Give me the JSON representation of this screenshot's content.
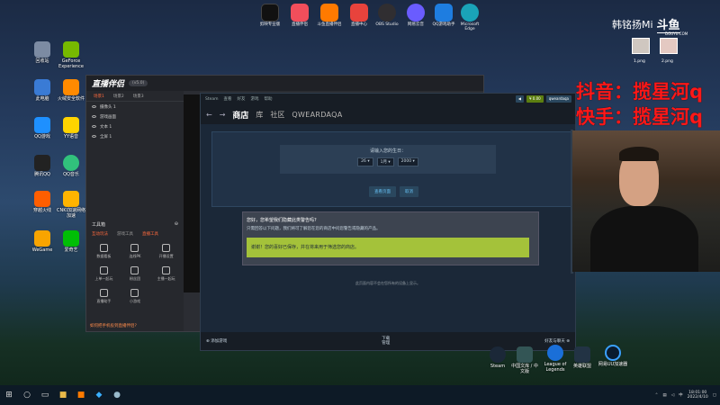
{
  "top_icons": [
    {
      "label": "剪映专业版",
      "color": "#111111"
    },
    {
      "label": "直播伴侣",
      "color": "#f24e5b"
    },
    {
      "label": "斗鱼直播伴侣",
      "color": "#ff7a00"
    },
    {
      "label": "直播中心",
      "color": "#e8433c"
    },
    {
      "label": "OBS Studio",
      "color": "#302e31"
    },
    {
      "label": "网易云音",
      "color": "#6a5cff"
    },
    {
      "label": "QQ游戏助手",
      "color": "#1e7de0"
    },
    {
      "label": "Microsoft Edge",
      "color": "#1aa3b8"
    }
  ],
  "desktop_icons": [
    {
      "label": "回收站",
      "color": "#7c8ba3"
    },
    {
      "label": "GeForce Experience",
      "color": "#76b900"
    },
    {
      "label": "此电脑",
      "color": "#3a7bd5"
    },
    {
      "label": "火绒安全软件",
      "color": "#ff8a00"
    },
    {
      "label": "QQ游戏",
      "color": "#1e90ff"
    },
    {
      "label": "YY语音",
      "color": "#ffd400"
    },
    {
      "label": "腾讯QQ",
      "color": "#222222"
    },
    {
      "label": "QQ音乐",
      "color": "#31c27c"
    },
    {
      "label": "穿越火线",
      "color": "#ff5e00"
    },
    {
      "label": "CNKI加速网络加速",
      "color": "#ffb400"
    },
    {
      "label": "WeGame",
      "color": "#f8a400"
    },
    {
      "label": "爱奇艺",
      "color": "#00be06"
    }
  ],
  "tool": {
    "logo": "直播伴侣",
    "version": "(v5.0)",
    "tabs": [
      "场景1",
      "场景2",
      "场景3"
    ],
    "sources": [
      "摄像头 1",
      "游戏画面",
      "文本 1",
      "全屏 1"
    ],
    "toolbox_title": "工具箱",
    "toolbox_tabs": [
      "互动玩法",
      "游戏工具",
      "直播工具"
    ],
    "tools": [
      "数据看板",
      "连线PK",
      "开播设置",
      "上单一起玩",
      "粉丝团",
      "主播一起玩",
      "直播助手",
      "小游戏",
      ""
    ],
    "tip": "如何把手机投到直播伴侣?"
  },
  "steam": {
    "menu": [
      "Steam",
      "查看",
      "好友",
      "游戏",
      "帮助"
    ],
    "nav": {
      "back": "←",
      "forward": "→",
      "store": "商店",
      "library": "库",
      "community": "社区",
      "user": "QWEARDAQA"
    },
    "topright": {
      "btn1": "◀",
      "btn2": "¥ 0.00",
      "account": "qweardaqa"
    },
    "age": {
      "label": "请输入您的生日：",
      "day": "26",
      "month": "1月",
      "year": "2000",
      "view": "查看页面",
      "cancel": "取消"
    },
    "dialog": {
      "question": "您好，您希望我们隐藏此类警告吗?",
      "desc": "只需回答以下问题，我们将可了解您在您的商店中问您警告或隐藏的产品。",
      "confirm": "谢谢！您的喜好已保存，并在将来用于筛选您的商店。"
    },
    "foot_note": "此页面内容不会在您所有的设备上显示。",
    "bottom": {
      "add": "添加游戏",
      "downloads": "下载",
      "downloads_sub": "管理",
      "friends": "好友与聊天"
    }
  },
  "overlay": {
    "name": "韩铭扬Mi",
    "douyu": "斗鱼",
    "douyu_sub": "DOUYU.COM",
    "social_line1": "抖音：揽星河q",
    "social_line2": "快手：揽星河q",
    "thumb1": "1.png",
    "thumb2": "2.png"
  },
  "taskbar_right": {
    "apps": [
      "Steam",
      "中国文库 / 中文版",
      "League of Legends",
      "英雄联盟",
      "网易UU加速器"
    ],
    "time": "18:01:00",
    "date": "2022/4/10",
    "lang": "中"
  }
}
